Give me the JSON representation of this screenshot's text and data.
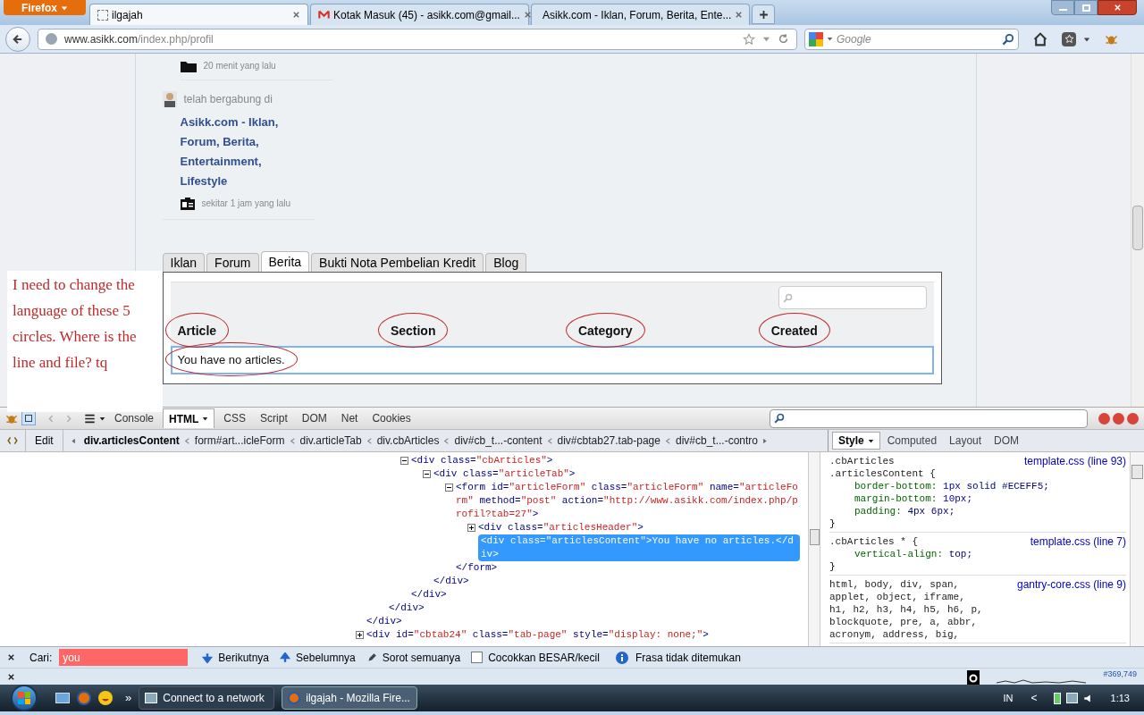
{
  "browser": {
    "menu_button": "Firefox",
    "tabs": [
      {
        "title": "ilgajah",
        "selected": true,
        "kind": "blank"
      },
      {
        "title": "Kotak Masuk (45) - asikk.com@gmail...",
        "selected": false,
        "kind": "mail"
      },
      {
        "title": "Asikk.com - Iklan, Forum, Berita, Ente...",
        "selected": false,
        "kind": "site"
      }
    ],
    "url_host": "www.asikk.com",
    "url_path": "/index.php/profil",
    "search_placeholder": "Google"
  },
  "page": {
    "activity": [
      {
        "kind": "folder",
        "text": "20 menit yang lalu"
      },
      {
        "kind": "joined",
        "label": "telah bergabung di",
        "link": "Asikk.com - Iklan, Forum, Berita, Entertainment, Lifestyle",
        "time": "sekitar 1 jam yang lalu"
      }
    ],
    "tabs": [
      {
        "label": "Iklan",
        "selected": false
      },
      {
        "label": "Forum",
        "selected": false
      },
      {
        "label": "Berita",
        "selected": true
      },
      {
        "label": "Bukti Nota Pembelian Kredit",
        "selected": false
      },
      {
        "label": "Blog",
        "selected": false
      }
    ],
    "columns": [
      "Article",
      "Section",
      "Category",
      "Created"
    ],
    "empty_message": "You have no articles.",
    "note": "I need to change the language of these 5 circles. Where is the line and file? tq"
  },
  "firebug": {
    "tabs": [
      {
        "label": "Console",
        "selected": false
      },
      {
        "label": "HTML",
        "selected": true
      },
      {
        "label": "CSS",
        "selected": false
      },
      {
        "label": "Script",
        "selected": false
      },
      {
        "label": "DOM",
        "selected": false
      },
      {
        "label": "Net",
        "selected": false
      },
      {
        "label": "Cookies",
        "selected": false
      }
    ],
    "edit_button": "Edit",
    "breadcrumbs": [
      {
        "label": "div.articlesContent",
        "selected": true
      },
      {
        "label": "form#art...icleForm",
        "selected": false
      },
      {
        "label": "div.articleTab",
        "selected": false
      },
      {
        "label": "div.cbArticles",
        "selected": false
      },
      {
        "label": "div#cb_t...-content",
        "selected": false
      },
      {
        "label": "div#cbtab27.tab-page",
        "selected": false
      },
      {
        "label": "div#cb_t...-contro",
        "selected": false
      }
    ],
    "side_tabs": [
      {
        "label": "Style",
        "selected": true
      },
      {
        "label": "Computed",
        "selected": false
      },
      {
        "label": "Layout",
        "selected": false
      },
      {
        "label": "DOM",
        "selected": false
      }
    ],
    "html_tree": [
      {
        "children": [
          {
            "children": [
              {
                "expanded": true,
                "selected": false,
                "open": [
                  {
                    "kind": "tag",
                    "text": "<div "
                  },
                  {
                    "kind": "attr",
                    "text": "class="
                  },
                  {
                    "kind": "value",
                    "text": "\"cbArticles\""
                  },
                  {
                    "kind": "tag",
                    "text": ">"
                  }
                ],
                "children": [
                  {
                    "expanded": true,
                    "selected": false,
                    "open": [
                      {
                        "kind": "tag",
                        "text": "<div "
                      },
                      {
                        "kind": "attr",
                        "text": "class="
                      },
                      {
                        "kind": "value",
                        "text": "\"articleTab\""
                      },
                      {
                        "kind": "tag",
                        "text": ">"
                      }
                    ],
                    "children": [
                      {
                        "expanded": true,
                        "selected": false,
                        "open": [
                          {
                            "kind": "tag",
                            "text": "<form "
                          },
                          {
                            "kind": "attr",
                            "text": "id="
                          },
                          {
                            "kind": "value",
                            "text": "\"articleForm\" "
                          },
                          {
                            "kind": "attr",
                            "text": "class="
                          },
                          {
                            "kind": "value",
                            "text": "\"articleForm\" "
                          },
                          {
                            "kind": "attr",
                            "text": "name="
                          },
                          {
                            "kind": "value",
                            "text": "\"articleForm\" "
                          },
                          {
                            "kind": "attr",
                            "text": "method="
                          },
                          {
                            "kind": "value",
                            "text": "\"post\" "
                          },
                          {
                            "kind": "attr",
                            "text": "action="
                          },
                          {
                            "kind": "value",
                            "text": "\"http://www.asikk.com/index.php/profil?tab=27\""
                          },
                          {
                            "kind": "tag",
                            "text": ">"
                          }
                        ],
                        "children": [
                          {
                            "expanded": false,
                            "selected": false,
                            "open": [
                              {
                                "kind": "tag",
                                "text": "<div "
                              },
                              {
                                "kind": "attr",
                                "text": "class="
                              },
                              {
                                "kind": "value",
                                "text": "\"articlesHeader\""
                              },
                              {
                                "kind": "tag",
                                "text": ">"
                              }
                            ]
                          },
                          {
                            "selected": true,
                            "open": [
                              {
                                "kind": "tag",
                                "text": "<div "
                              },
                              {
                                "kind": "attr",
                                "text": "class="
                              },
                              {
                                "kind": "value",
                                "text": "\"articlesContent\""
                              },
                              {
                                "kind": "tag",
                                "text": ">"
                              },
                              {
                                "kind": "text",
                                "text": "You have no articles."
                              },
                              {
                                "kind": "tag",
                                "text": "</div>"
                              }
                            ]
                          }
                        ],
                        "close": "</form>"
                      }
                    ],
                    "close": "</div>"
                  }
                ],
                "close": "</div>"
              }
            ],
            "close": "</div>"
          }
        ],
        "close": "</div>"
      },
      {
        "expanded": false,
        "selected": false,
        "open": [
          {
            "kind": "tag",
            "text": "<div "
          },
          {
            "kind": "attr",
            "text": "id="
          },
          {
            "kind": "value",
            "text": "\"cbtab24\" "
          },
          {
            "kind": "attr",
            "text": "class="
          },
          {
            "kind": "value",
            "text": "\"tab-page\" "
          },
          {
            "kind": "attr",
            "text": "style="
          },
          {
            "kind": "value",
            "text": "\"display: none;\""
          },
          {
            "kind": "tag",
            "text": ">"
          }
        ]
      }
    ],
    "css_rules": [
      {
        "selector": [
          ".cbArticles",
          ".articlesContent {"
        ],
        "source": "template.css (line 93)",
        "declarations": [
          {
            "property": "border-bottom:",
            "value": "1px solid #ECEFF5;"
          },
          {
            "property": "margin-bottom:",
            "value": "10px;"
          },
          {
            "property": "padding:",
            "value": "4px 6px;"
          }
        ],
        "close": "}"
      },
      {
        "selector": [
          ".cbArticles * {"
        ],
        "source": "template.css (line 7)",
        "declarations": [
          {
            "property": "vertical-align:",
            "value": "top;"
          }
        ],
        "close": "}"
      },
      {
        "selector": [
          "html, body, div, span,",
          "applet, object, iframe,",
          "h1, h2, h3, h4, h5, h6, p,",
          "blockquote, pre, a, abbr,",
          "acronym, address, big,"
        ],
        "source": "gantry-core.css (line 9)"
      }
    ]
  },
  "find_bar": {
    "label": "Cari:",
    "value": "you",
    "not_found": true,
    "next": "Berikutnya",
    "previous": "Sebelumnya",
    "highlight": "Sorot semuanya",
    "match_case": {
      "label": "Cocokkan BESAR/kecil",
      "checked": false
    },
    "status": "Frasa tidak ditemukan"
  },
  "status_bar": {
    "counter": "#369,749"
  },
  "taskbar": {
    "overflow": "»",
    "tasks": [
      {
        "title": "Connect to a network",
        "selected": false,
        "kind": "network"
      },
      {
        "title": "ilgajah - Mozilla Fire...",
        "selected": true,
        "kind": "firefox"
      }
    ],
    "language": "IN",
    "tray_toggle": "<",
    "clock": "1:13"
  }
}
